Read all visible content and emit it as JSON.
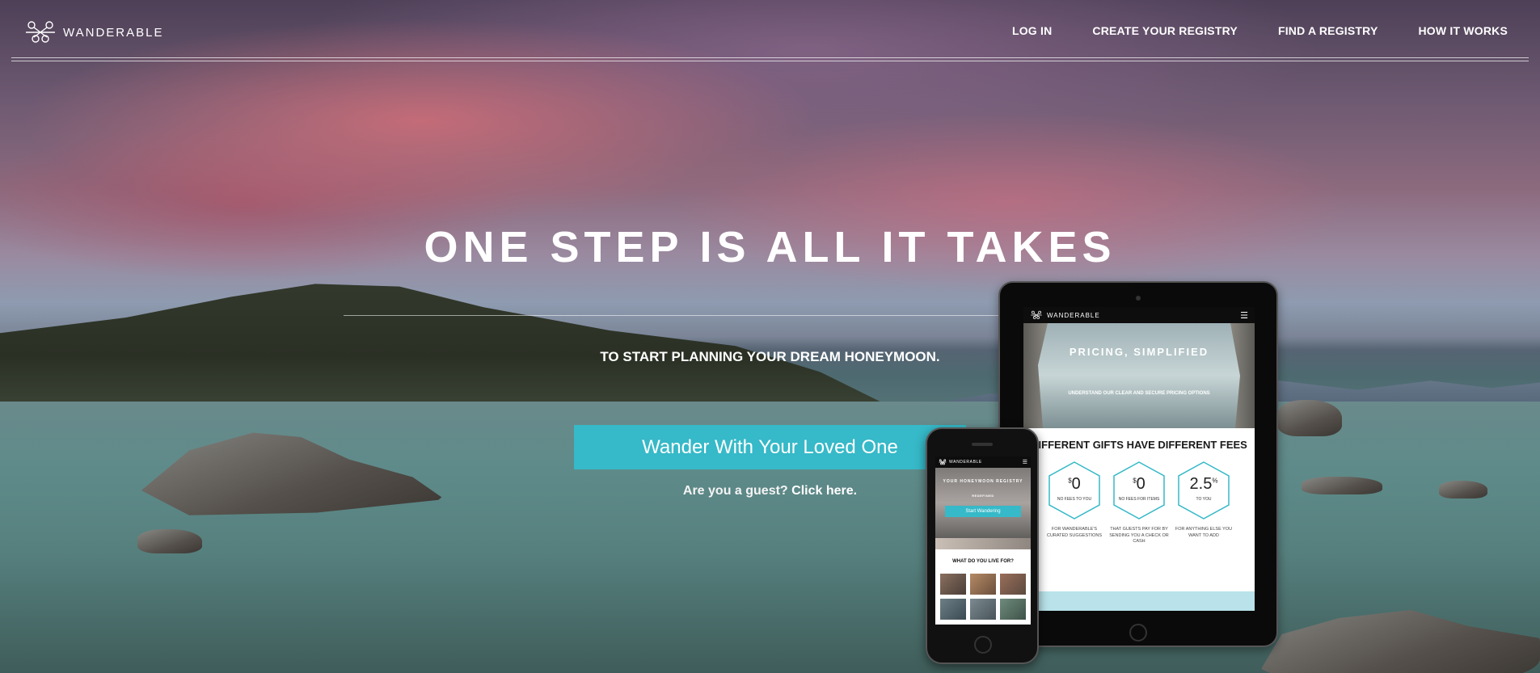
{
  "nav": {
    "logo_text": "WANDERABLE",
    "links": [
      "LOG IN",
      "CREATE YOUR REGISTRY",
      "FIND A REGISTRY",
      "HOW IT WORKS"
    ]
  },
  "hero": {
    "headline": "ONE STEP IS ALL IT TAKES",
    "subhead": "TO START PLANNING YOUR DREAM HONEYMOON.",
    "cta_label": "Wander With Your Loved One",
    "guest_prefix": "Are you a guest?",
    "guest_link": "Click here."
  },
  "tablet": {
    "brand": "WANDERABLE",
    "hero_title": "PRICING, SIMPLIFIED",
    "hero_sub": "UNDERSTAND OUR CLEAR AND SECURE PRICING OPTIONS",
    "section_title": "DIFFERENT GIFTS HAVE DIFFERENT FEES",
    "fees": [
      {
        "currency": "$",
        "value": "0",
        "label": "NO FEES TO YOU",
        "desc": "FOR WANDERABLE'S CURATED SUGGESTIONS"
      },
      {
        "currency": "$",
        "value": "0",
        "label": "NO FEES FOR ITEMS",
        "desc": "THAT GUESTS PAY FOR BY SENDING YOU A CHECK OR CASH"
      },
      {
        "value": "2.5",
        "unit": "%",
        "label": "TO YOU",
        "desc": "FOR ANYTHING ELSE YOU WANT TO ADD"
      }
    ]
  },
  "phone": {
    "brand": "WANDERABLE",
    "hero_text": "YOUR HONEYMOON REGISTRY",
    "hero_sub": "REDEFINED",
    "start_label": "Start Wandering",
    "question": "WHAT DO YOU LIVE FOR?"
  },
  "colors": {
    "accent": "#36b9c8",
    "white": "#ffffff"
  }
}
